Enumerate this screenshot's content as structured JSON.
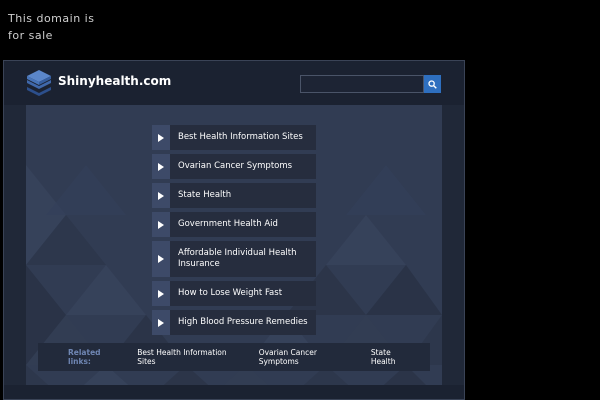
{
  "notice": {
    "line1": "This domain is",
    "line2": "for sale"
  },
  "header": {
    "site_name": "Shinyhealth.com",
    "search_placeholder": "",
    "search_icon": "search-icon",
    "logo_icon": "stacked-layers-icon"
  },
  "links": [
    {
      "label": "Best Health Information Sites"
    },
    {
      "label": "Ovarian Cancer Symptoms"
    },
    {
      "label": "State Health"
    },
    {
      "label": "Government Health Aid"
    },
    {
      "label": "Affordable Individual Health Insurance"
    },
    {
      "label": "How to Lose Weight Fast"
    },
    {
      "label": "High Blood Pressure Remedies"
    }
  ],
  "related": {
    "title": "Related links:",
    "items": [
      {
        "label": "Best Health Information Sites"
      },
      {
        "label": "Ovarian Cancer Symptoms"
      },
      {
        "label": "State Health"
      }
    ]
  },
  "colors": {
    "accent": "#2e6fbf",
    "arrow_box": "#3d4a68",
    "content_bg": "#313c53",
    "header_bg": "#1b2231"
  }
}
